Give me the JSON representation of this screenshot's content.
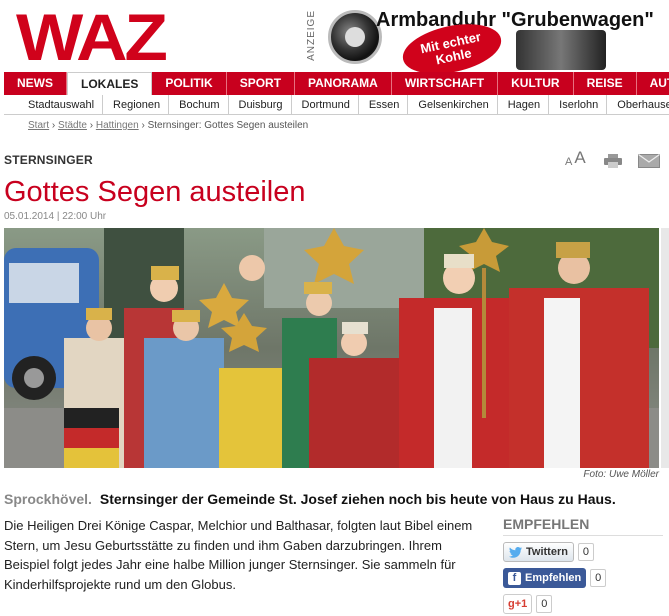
{
  "site": {
    "logo": "WAZ"
  },
  "ad": {
    "label": "ANZEIGE",
    "title": "Armbanduhr \"Grubenwagen\"",
    "badge": "Mit echter Kohle"
  },
  "nav": {
    "items": [
      "NEWS",
      "LOKALES",
      "POLITIK",
      "SPORT",
      "PANORAMA",
      "WIRTSCHAFT",
      "KULTUR",
      "REISE",
      "AUTO"
    ],
    "active": "LOKALES"
  },
  "subnav": {
    "items": [
      "Stadtauswahl",
      "Regionen",
      "Bochum",
      "Duisburg",
      "Dortmund",
      "Essen",
      "Gelsenkirchen",
      "Hagen",
      "Iserlohn",
      "Oberhausen"
    ]
  },
  "breadcrumb": {
    "start": "Start",
    "cities": "Städte",
    "city": "Hattingen",
    "current": "Sternsinger: Gottes Segen austeilen",
    "sep": "›"
  },
  "article": {
    "kicker": "STERNSINGER",
    "title": "Gottes Segen austeilen",
    "dateline": "05.01.2014 | 22:00 Uhr",
    "photo_credit": "Foto: Uwe Möller",
    "place": "Sprockhövel.",
    "lead": "Sternsinger der Gemeinde St. Josef ziehen noch bis heute von Haus zu Haus.",
    "body": "Die Heiligen Drei Könige Caspar, Melchior und Balthasar, folgten laut Bibel einem Stern, um Jesu Geburtsstätte zu finden und ihm Gaben darzubringen. Ihrem Beispiel folgt jedes Jahr eine halbe Million junger Sternsinger. Sie sammeln für Kinderhilfsprojekte rund um den Globus."
  },
  "tools": {
    "font_small": "A",
    "font_big": "A"
  },
  "share": {
    "title": "EMPFEHLEN",
    "twitter_label": "Twittern",
    "twitter_count": "0",
    "facebook_label": "Empfehlen",
    "facebook_count": "0",
    "gplus_label": "g+1",
    "gplus_count": "0"
  },
  "colors": {
    "brand_red": "#c8001e",
    "facebook": "#3b5998"
  }
}
